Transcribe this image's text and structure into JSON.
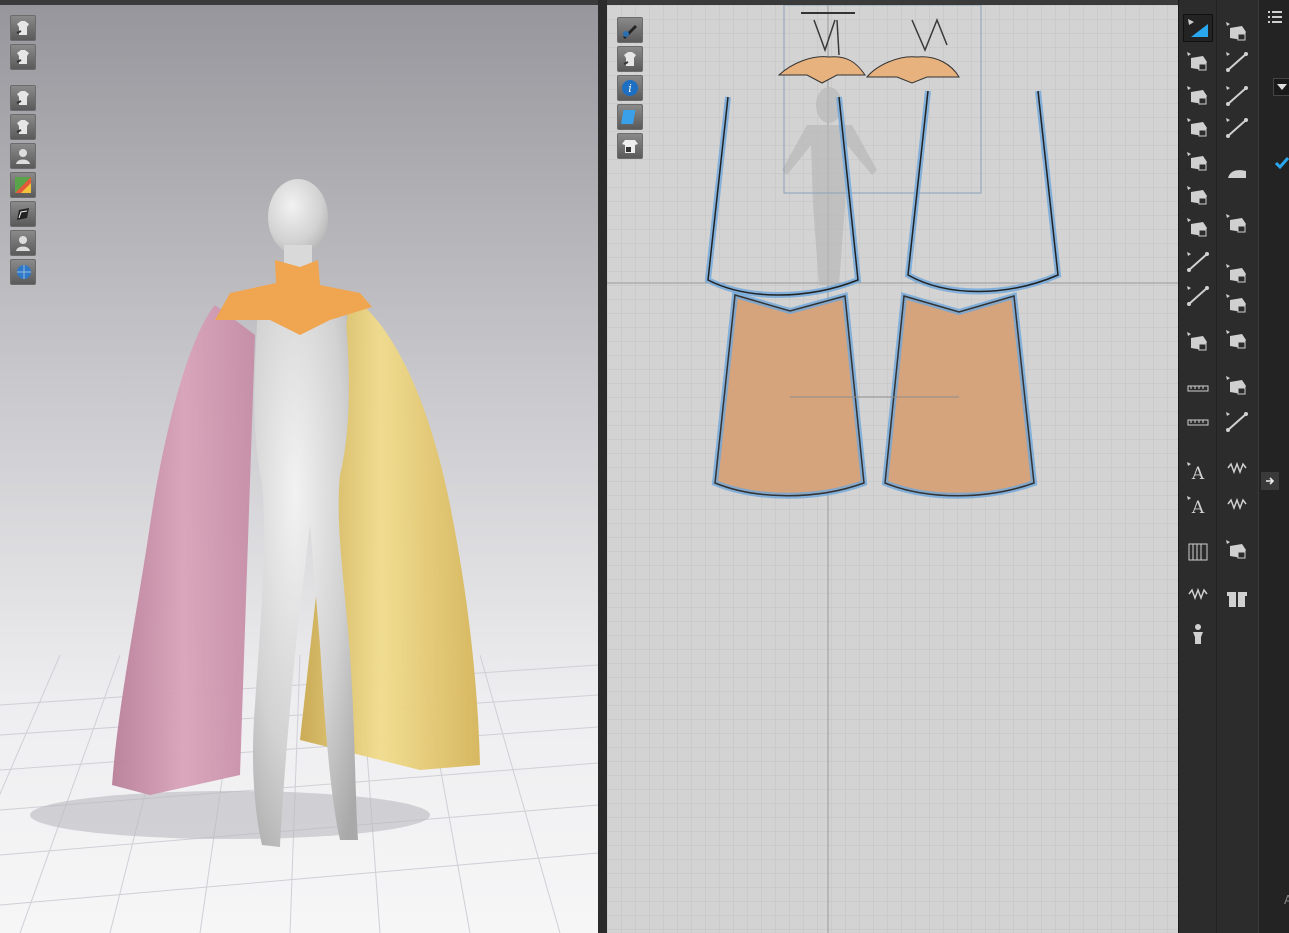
{
  "app": {
    "colors": {
      "background": "#1c1c1c",
      "viewport_3d_top": "#9a9aa0",
      "viewport_3d_floor": "#f1f1f3",
      "viewport_2d_bg": "#d3d3d3",
      "pattern_fill": "#d6a47c",
      "pattern_outline": "#6fa8dc",
      "cape_left": "#c98fa8",
      "cape_right": "#e0c46c",
      "collar": "#f0a550",
      "accent": "#2aa8ef"
    }
  },
  "viewport3d": {
    "toolbar": [
      {
        "name": "show-avatar-icon"
      },
      {
        "name": "show-garment-icon"
      },
      {
        "name": "garment-view-icon"
      },
      {
        "name": "texture-view-icon"
      },
      {
        "name": "avatar-view-icon"
      },
      {
        "name": "color-map-icon"
      },
      {
        "name": "wireframe-icon"
      },
      {
        "name": "avatar-silhouette-icon"
      },
      {
        "name": "environment-icon"
      }
    ]
  },
  "viewport2d": {
    "toolbar": [
      {
        "name": "pen-visibility-icon"
      },
      {
        "name": "pattern-visibility-icon"
      },
      {
        "name": "info-icon"
      },
      {
        "name": "layer-icon"
      },
      {
        "name": "lock-pattern-icon"
      }
    ]
  },
  "tools_primary": [
    {
      "name": "transform-pattern-icon",
      "active": true
    },
    {
      "name": "edit-point-icon"
    },
    {
      "name": "edit-curvature-icon"
    },
    {
      "name": "polygon-icon"
    },
    {
      "name": "internal-polygon-icon"
    },
    {
      "name": "dart-icon"
    },
    {
      "name": "shield-icon"
    },
    {
      "name": "edit-segment-icon"
    },
    {
      "name": "trace-icon"
    },
    {
      "name": "fold-icon"
    },
    {
      "name": "measure-icon"
    },
    {
      "name": "ruler-icon"
    },
    {
      "name": "text-annotation-icon"
    },
    {
      "name": "text-label-icon"
    },
    {
      "name": "grid-pattern-icon"
    },
    {
      "name": "tape-icon"
    },
    {
      "name": "avatar-pose-icon"
    }
  ],
  "tools_secondary": [
    {
      "name": "arrange-icon"
    },
    {
      "name": "edit-sewing-icon"
    },
    {
      "name": "segment-sewing-icon"
    },
    {
      "name": "free-sewing-icon"
    },
    {
      "name": "steam-iron-icon"
    },
    {
      "name": "garment-fit-icon"
    },
    {
      "name": "fabric-icon"
    },
    {
      "name": "button-icon"
    },
    {
      "name": "buttonhole-icon"
    },
    {
      "name": "topstitch-icon"
    },
    {
      "name": "seam-line-icon"
    },
    {
      "name": "zipper-icon"
    },
    {
      "name": "elastic-icon"
    },
    {
      "name": "add-pattern-icon"
    },
    {
      "name": "gift-icon"
    }
  ],
  "right_panel": {
    "menu_icon": "list-icon",
    "dropdown_icon": "chevron-down-icon",
    "check_icon": "check-icon",
    "collapse_icon": "arrow-right-icon",
    "footer_letter": "A"
  }
}
